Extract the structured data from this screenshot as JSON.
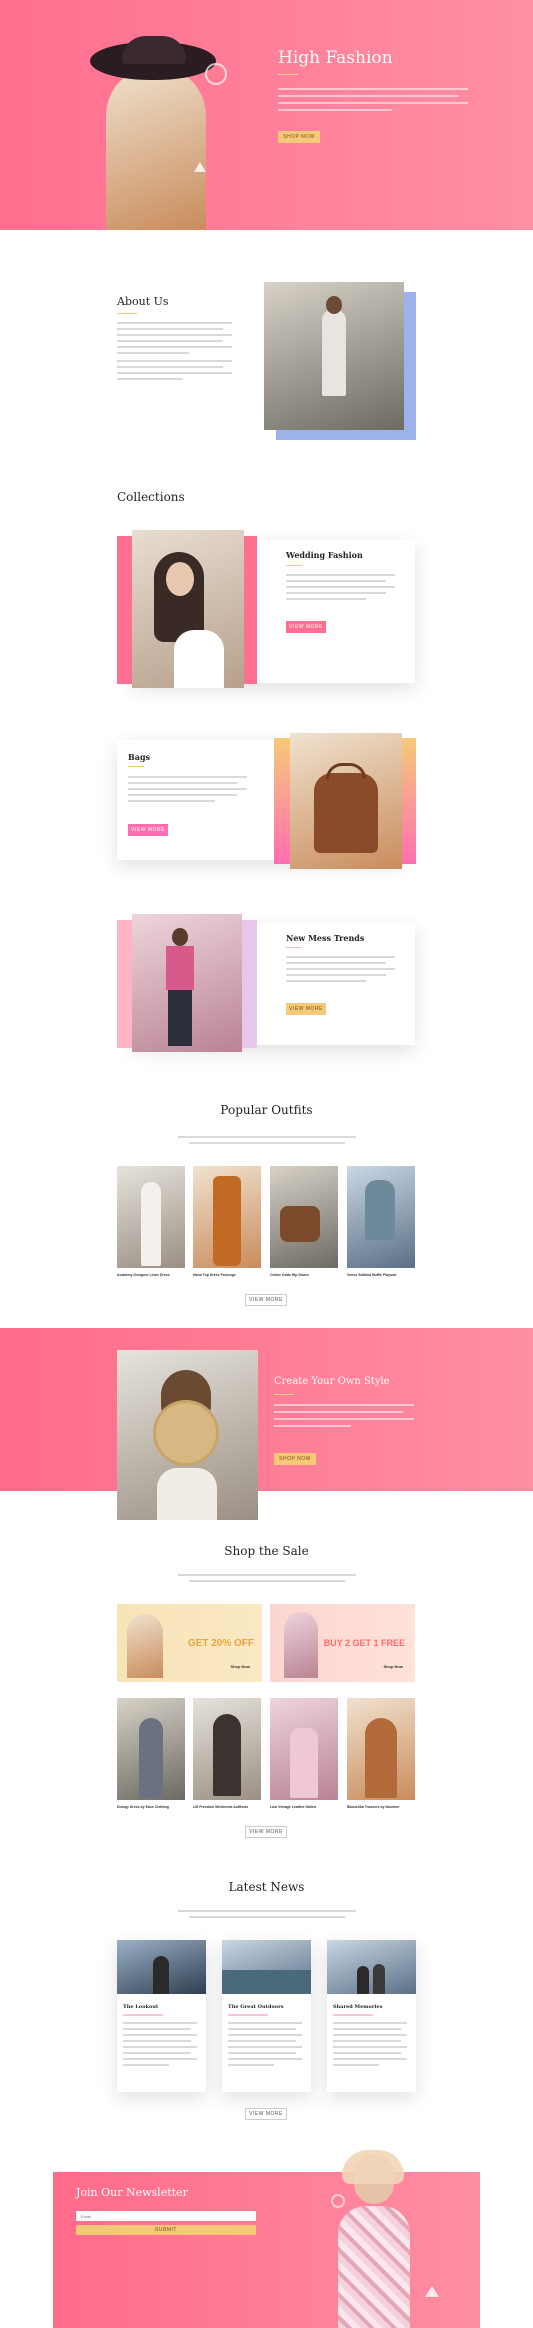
{
  "colors": {
    "accent_pink": "#ff6f8f",
    "accent_yellow": "#f6c978"
  },
  "hero": {
    "title": "High Fashion",
    "button": "SHOP NOW"
  },
  "about": {
    "title": "About Us"
  },
  "collections": {
    "title": "Collections",
    "items": [
      {
        "title": "Wedding Fashion",
        "button": "VIEW MORE"
      },
      {
        "title": "Bags",
        "button": "VIEW MORE"
      },
      {
        "title": "New Mess Trends",
        "button": "VIEW MORE"
      }
    ]
  },
  "popular": {
    "title": "Popular Outfits",
    "items": [
      {
        "label": "Academy Designer Linen Dress"
      },
      {
        "label": "Hand Top Dress Prolonge"
      },
      {
        "label": "Online Odds Hip Shoes"
      },
      {
        "label": "Venus Sailbird Buffle Playsuit"
      }
    ],
    "button": "VIEW MORE"
  },
  "create": {
    "title": "Create Your Own Style",
    "button": "SHOP NOW"
  },
  "sale": {
    "title": "Shop the Sale",
    "banners": [
      {
        "headline": "GET 20% OFF",
        "link": "Shop Now"
      },
      {
        "headline": "BUY 2 GET 1 FREE",
        "link": "Shop Now"
      }
    ],
    "items": [
      {
        "label": "Dumpy Dress by Ease Clothing"
      },
      {
        "label": "Lift Freedom Weekends Aufflows"
      },
      {
        "label": "Last Vintage Leather Nailed"
      },
      {
        "label": "Babushka Trousers by Nosimm"
      }
    ],
    "button": "VIEW MORE"
  },
  "news": {
    "title": "Latest News",
    "posts": [
      {
        "title": "The Lookout"
      },
      {
        "title": "The Great Outdoors"
      },
      {
        "title": "Shared Memories"
      }
    ],
    "button": "VIEW MORE"
  },
  "newsletter": {
    "title": "Join Our Newsletter",
    "placeholder": "Email",
    "button": "SUBMIT"
  }
}
